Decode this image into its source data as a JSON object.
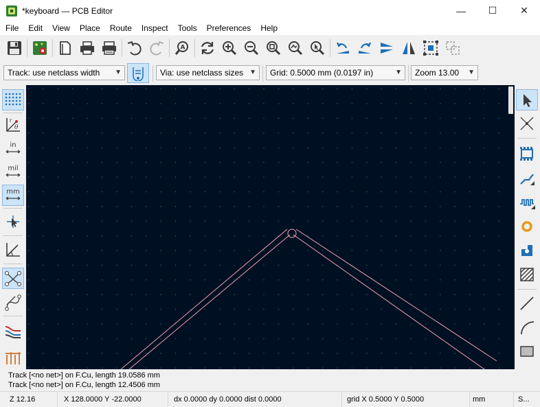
{
  "window": {
    "title": "*keyboard — PCB Editor",
    "minimize_glyph": "—",
    "maximize_glyph": "☐",
    "close_glyph": "✕"
  },
  "menu": [
    "File",
    "Edit",
    "View",
    "Place",
    "Route",
    "Inspect",
    "Tools",
    "Preferences",
    "Help"
  ],
  "options": {
    "track_width": "Track: use netclass width",
    "via_size": "Via: use netclass sizes",
    "grid": "Grid: 0.5000 mm (0.0197 in)",
    "zoom": "Zoom 13.00"
  },
  "left_toolbar": {
    "units_in": "in",
    "units_mil": "mil",
    "units_mm": "mm"
  },
  "messages": [
    "Track [<no net>] on F.Cu, length 19.0586 mm",
    "Track [<no net>] on F.Cu, length 12.4506 mm"
  ],
  "status": {
    "zoom": "Z 12.16",
    "coords": "X 128.0000  Y -22.0000",
    "delta": "dx 0.0000  dy 0.0000  dist 0.0000",
    "grid": "grid X 0.5000  Y 0.5000",
    "units": "mm",
    "mode": "S..."
  },
  "colors": {
    "canvas_bg": "#001023",
    "track_outline": "#f0a0b0",
    "grid_dot": "#5a6a80",
    "active_tool_bg": "#cce4f7"
  }
}
